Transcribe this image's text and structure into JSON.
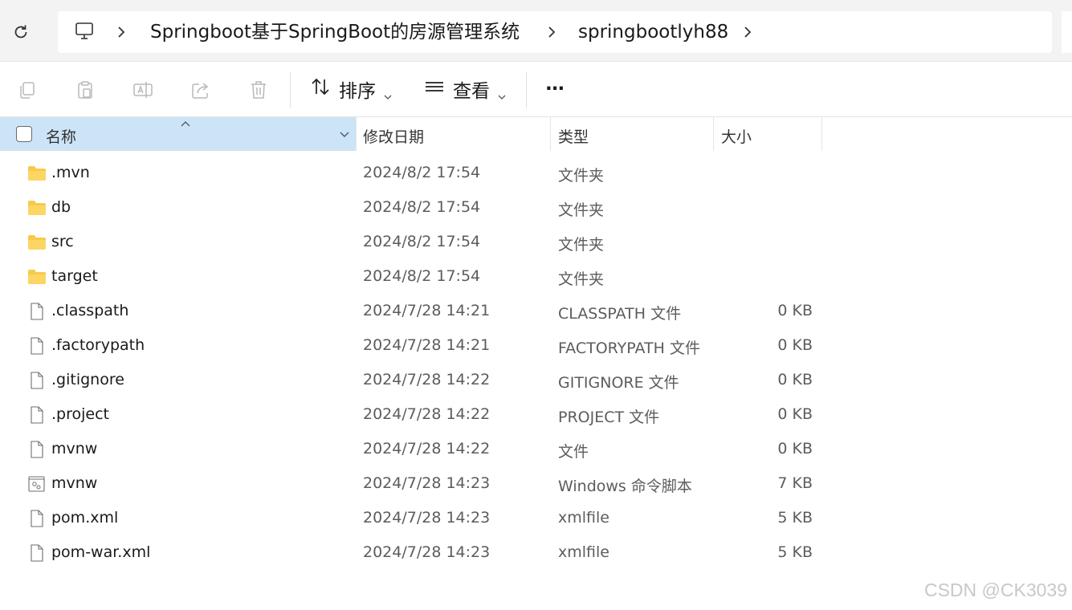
{
  "breadcrumb": {
    "items": [
      "Springboot基于SpringBoot的房源管理系统",
      "springbootlyh88"
    ]
  },
  "toolbar": {
    "sort_label": "排序",
    "view_label": "查看",
    "more_label": "···"
  },
  "columns": {
    "name": "名称",
    "modified": "修改日期",
    "type": "类型",
    "size": "大小"
  },
  "files": [
    {
      "icon": "folder-icon",
      "name": ".mvn",
      "modified": "2024/8/2 17:54",
      "type": "文件夹",
      "size": ""
    },
    {
      "icon": "folder-icon",
      "name": "db",
      "modified": "2024/8/2 17:54",
      "type": "文件夹",
      "size": ""
    },
    {
      "icon": "folder-icon",
      "name": "src",
      "modified": "2024/8/2 17:54",
      "type": "文件夹",
      "size": ""
    },
    {
      "icon": "folder-icon",
      "name": "target",
      "modified": "2024/8/2 17:54",
      "type": "文件夹",
      "size": ""
    },
    {
      "icon": "file-icon",
      "name": ".classpath",
      "modified": "2024/7/28 14:21",
      "type": "CLASSPATH 文件",
      "size": "0 KB"
    },
    {
      "icon": "file-icon",
      "name": ".factorypath",
      "modified": "2024/7/28 14:21",
      "type": "FACTORYPATH 文件",
      "size": "0 KB"
    },
    {
      "icon": "file-icon",
      "name": ".gitignore",
      "modified": "2024/7/28 14:22",
      "type": "GITIGNORE 文件",
      "size": "0 KB"
    },
    {
      "icon": "file-icon",
      "name": ".project",
      "modified": "2024/7/28 14:22",
      "type": "PROJECT 文件",
      "size": "0 KB"
    },
    {
      "icon": "file-icon",
      "name": "mvnw",
      "modified": "2024/7/28 14:22",
      "type": "文件",
      "size": "0 KB"
    },
    {
      "icon": "script-file-icon",
      "name": "mvnw",
      "modified": "2024/7/28 14:23",
      "type": "Windows 命令脚本",
      "size": "7 KB"
    },
    {
      "icon": "file-icon",
      "name": "pom.xml",
      "modified": "2024/7/28 14:23",
      "type": "xmlfile",
      "size": "5 KB"
    },
    {
      "icon": "file-icon",
      "name": "pom-war.xml",
      "modified": "2024/7/28 14:23",
      "type": "xmlfile",
      "size": "5 KB"
    }
  ],
  "watermark": "CSDN @CK3039",
  "colors": {
    "selected_header": "#cce4f7",
    "folder": "#f8c94a"
  }
}
